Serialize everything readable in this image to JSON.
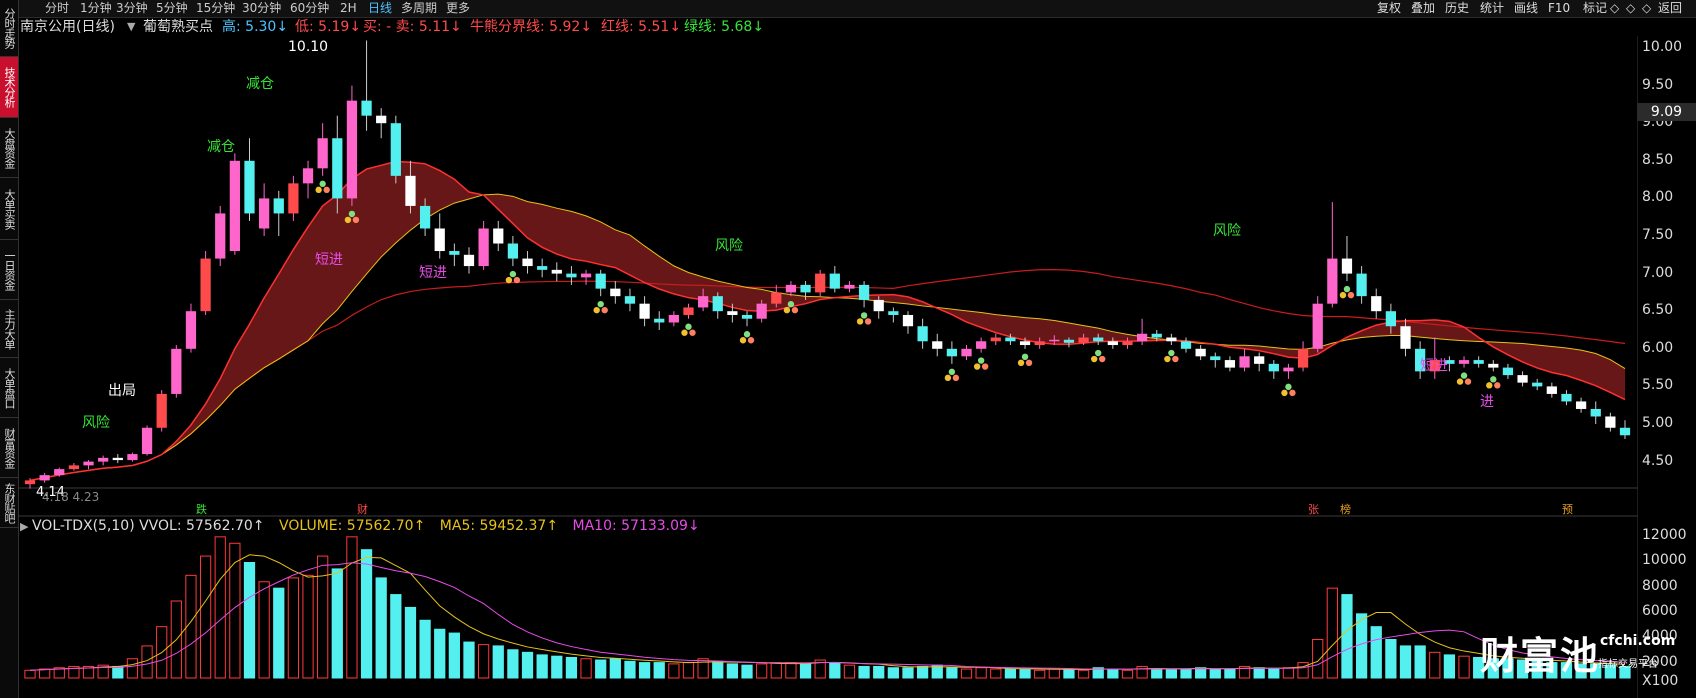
{
  "toolbar": {
    "timeframes": [
      "分时",
      "1分钟",
      "3分钟",
      "5分钟",
      "15分钟",
      "30分钟",
      "60分钟",
      "2H",
      "日线",
      "多周期",
      "更多"
    ],
    "active_timeframe": "日线",
    "right_buttons": [
      "复权",
      "叠加",
      "历史",
      "统计",
      "画线",
      "F10",
      "标记",
      "◇",
      "◇",
      "◇",
      "返回"
    ]
  },
  "sidebar": {
    "items": [
      "分时走势",
      "技术分析",
      "大盘资金",
      "大单买卖",
      "一日资金",
      "主力大单",
      "大单盘口",
      "财富资金",
      "东财贴吧"
    ],
    "active": "技术分析"
  },
  "header": {
    "stock": "南京公用(日线)",
    "indicator": "葡萄熟买点",
    "high_label": "高: 5.30↓",
    "low_label": "低: 5.19↓",
    "buysell_label": "买: - 卖: 5.11↓",
    "bull_label": "牛熊分界线: 5.92↓",
    "red_label": "红线: 5.51↓",
    "green_label": "绿线: 5.68↓"
  },
  "price_axis": {
    "ticks": [
      "10.00",
      "9.50",
      "9.00",
      "8.50",
      "8.00",
      "7.50",
      "7.00",
      "6.50",
      "6.00",
      "5.50",
      "5.00",
      "4.50"
    ],
    "current_price": "9.09",
    "max_label": "10.10",
    "min_label": "4.14",
    "min_label2": "4.18 4.23"
  },
  "signals": [
    {
      "text": "风险",
      "color": "#37e337"
    },
    {
      "text": "出局",
      "color": "#ffffff"
    },
    {
      "text": "减仓",
      "color": "#37e337"
    },
    {
      "text": "减仓",
      "color": "#37e337"
    },
    {
      "text": "风险",
      "color": "#37e337"
    },
    {
      "text": "风险",
      "color": "#37e337"
    },
    {
      "text": "短进",
      "color": "#e84ce8"
    },
    {
      "text": "短进",
      "color": "#e84ce8"
    },
    {
      "text": "短进",
      "color": "#e84ce8"
    },
    {
      "text": "进",
      "color": "#e84ce8"
    }
  ],
  "events": [
    "跌",
    "财",
    "张",
    "榜",
    "预"
  ],
  "volume": {
    "label": "VOL-TDX(5,10) VVOL: 57562.70↑",
    "volume_label": "VOLUME: 57562.70↑",
    "ma5_label": "MA5: 59452.37↑",
    "ma10_label": "MA10: 57133.09↓",
    "ticks": [
      "12000",
      "10000",
      "8000",
      "6000",
      "4000",
      "2000"
    ],
    "unit": "X100"
  },
  "watermark": {
    "logo": "财富池",
    "domain": "cfchi.com",
    "slogan": "指标交易平台"
  },
  "colors": {
    "up": "#ff3a3a",
    "pink": "#ff66cc",
    "cyan": "#54f0f0",
    "green": "#37e337",
    "magenta": "#e84ce8",
    "yellow": "#e6c21a"
  },
  "chart_data": {
    "type": "candlestick",
    "price_range": [
      4.2,
      10.15
    ],
    "volume_range": [
      0,
      12000
    ],
    "candles": [
      [
        4.2,
        4.25,
        4.28,
        4.14
      ],
      [
        4.25,
        4.32,
        4.35,
        4.22
      ],
      [
        4.32,
        4.4,
        4.42,
        4.3
      ],
      [
        4.4,
        4.45,
        4.48,
        4.38
      ],
      [
        4.45,
        4.5,
        4.52,
        4.4
      ],
      [
        4.5,
        4.55,
        4.58,
        4.45
      ],
      [
        4.55,
        4.52,
        4.6,
        4.48
      ],
      [
        4.52,
        4.6,
        4.62,
        4.5
      ],
      [
        4.6,
        4.95,
        4.98,
        4.58
      ],
      [
        4.95,
        5.4,
        5.45,
        4.9
      ],
      [
        5.4,
        6.0,
        6.05,
        5.35
      ],
      [
        6.0,
        6.5,
        6.6,
        5.95
      ],
      [
        6.5,
        7.2,
        7.3,
        6.45
      ],
      [
        7.2,
        7.8,
        7.9,
        7.1
      ],
      [
        7.3,
        8.5,
        8.6,
        7.25
      ],
      [
        8.5,
        7.8,
        8.8,
        7.7
      ],
      [
        7.6,
        8.0,
        8.2,
        7.5
      ],
      [
        8.0,
        7.8,
        8.1,
        7.5
      ],
      [
        7.8,
        8.2,
        8.3,
        7.7
      ],
      [
        8.2,
        8.4,
        8.5,
        8.0
      ],
      [
        8.4,
        8.8,
        9.0,
        8.3
      ],
      [
        8.8,
        8.0,
        9.1,
        7.8
      ],
      [
        8.0,
        9.3,
        9.5,
        7.9
      ],
      [
        9.3,
        9.1,
        10.1,
        8.9
      ],
      [
        9.1,
        9.0,
        9.2,
        8.8
      ],
      [
        9.0,
        8.3,
        9.1,
        8.2
      ],
      [
        8.3,
        7.9,
        8.5,
        7.8
      ],
      [
        7.9,
        7.6,
        8.0,
        7.5
      ],
      [
        7.6,
        7.3,
        7.8,
        7.2
      ],
      [
        7.3,
        7.25,
        7.4,
        7.1
      ],
      [
        7.25,
        7.1,
        7.35,
        7.0
      ],
      [
        7.1,
        7.6,
        7.7,
        7.05
      ],
      [
        7.6,
        7.4,
        7.7,
        7.3
      ],
      [
        7.4,
        7.2,
        7.5,
        7.1
      ],
      [
        7.2,
        7.1,
        7.3,
        7.0
      ],
      [
        7.1,
        7.05,
        7.2,
        6.95
      ],
      [
        7.05,
        7.0,
        7.15,
        6.9
      ],
      [
        7.0,
        6.95,
        7.1,
        6.85
      ],
      [
        6.95,
        7.0,
        7.05,
        6.85
      ],
      [
        7.0,
        6.8,
        7.05,
        6.7
      ],
      [
        6.8,
        6.7,
        6.9,
        6.6
      ],
      [
        6.7,
        6.6,
        6.8,
        6.5
      ],
      [
        6.6,
        6.4,
        6.7,
        6.3
      ],
      [
        6.4,
        6.35,
        6.5,
        6.25
      ],
      [
        6.35,
        6.45,
        6.5,
        6.3
      ],
      [
        6.45,
        6.55,
        6.6,
        6.4
      ],
      [
        6.55,
        6.7,
        6.8,
        6.5
      ],
      [
        6.7,
        6.5,
        6.75,
        6.4
      ],
      [
        6.5,
        6.45,
        6.6,
        6.35
      ],
      [
        6.45,
        6.4,
        6.5,
        6.3
      ],
      [
        6.4,
        6.6,
        6.65,
        6.35
      ],
      [
        6.6,
        6.75,
        6.85,
        6.55
      ],
      [
        6.75,
        6.85,
        6.9,
        6.7
      ],
      [
        6.85,
        6.75,
        6.9,
        6.65
      ],
      [
        6.75,
        7.0,
        7.05,
        6.7
      ],
      [
        7.0,
        6.8,
        7.1,
        6.75
      ],
      [
        6.8,
        6.85,
        6.9,
        6.75
      ],
      [
        6.85,
        6.65,
        6.9,
        6.55
      ],
      [
        6.65,
        6.5,
        6.7,
        6.4
      ],
      [
        6.5,
        6.45,
        6.55,
        6.35
      ],
      [
        6.45,
        6.3,
        6.5,
        6.2
      ],
      [
        6.3,
        6.1,
        6.4,
        6.0
      ],
      [
        6.1,
        6.0,
        6.2,
        5.9
      ],
      [
        6.0,
        5.9,
        6.1,
        5.8
      ],
      [
        5.9,
        6.0,
        6.05,
        5.85
      ],
      [
        6.0,
        6.1,
        6.15,
        5.95
      ],
      [
        6.1,
        6.15,
        6.2,
        6.05
      ],
      [
        6.15,
        6.1,
        6.2,
        6.05
      ],
      [
        6.1,
        6.05,
        6.15,
        6.0
      ],
      [
        6.05,
        6.1,
        6.15,
        6.0
      ],
      [
        6.1,
        6.12,
        6.18,
        6.05
      ],
      [
        6.12,
        6.08,
        6.15,
        6.02
      ],
      [
        6.08,
        6.15,
        6.2,
        6.05
      ],
      [
        6.15,
        6.1,
        6.2,
        6.05
      ],
      [
        6.1,
        6.05,
        6.15,
        6.0
      ],
      [
        6.05,
        6.1,
        6.15,
        6.0
      ],
      [
        6.1,
        6.2,
        6.4,
        6.05
      ],
      [
        6.2,
        6.15,
        6.25,
        6.1
      ],
      [
        6.15,
        6.1,
        6.2,
        6.05
      ],
      [
        6.1,
        6.0,
        6.15,
        5.95
      ],
      [
        6.0,
        5.9,
        6.05,
        5.85
      ],
      [
        5.9,
        5.85,
        5.95,
        5.75
      ],
      [
        5.85,
        5.75,
        5.9,
        5.7
      ],
      [
        5.75,
        5.9,
        6.0,
        5.7
      ],
      [
        5.9,
        5.8,
        5.95,
        5.7
      ],
      [
        5.8,
        5.7,
        5.85,
        5.6
      ],
      [
        5.7,
        5.75,
        5.8,
        5.6
      ],
      [
        5.75,
        6.0,
        6.1,
        5.7
      ],
      [
        6.0,
        6.6,
        6.7,
        5.95
      ],
      [
        6.6,
        7.2,
        7.95,
        6.55
      ],
      [
        7.2,
        7.0,
        7.5,
        6.9
      ],
      [
        7.0,
        6.7,
        7.1,
        6.6
      ],
      [
        6.7,
        6.5,
        6.8,
        6.4
      ],
      [
        6.5,
        6.3,
        6.6,
        6.2
      ],
      [
        6.3,
        6.0,
        6.4,
        5.9
      ],
      [
        6.0,
        5.7,
        6.1,
        5.6
      ],
      [
        5.7,
        5.85,
        6.15,
        5.6
      ],
      [
        5.85,
        5.8,
        5.9,
        5.7
      ],
      [
        5.8,
        5.85,
        5.9,
        5.75
      ],
      [
        5.85,
        5.8,
        5.9,
        5.75
      ],
      [
        5.8,
        5.75,
        5.85,
        5.7
      ],
      [
        5.75,
        5.65,
        5.8,
        5.6
      ],
      [
        5.65,
        5.55,
        5.7,
        5.5
      ],
      [
        5.55,
        5.5,
        5.6,
        5.45
      ],
      [
        5.5,
        5.4,
        5.55,
        5.35
      ],
      [
        5.4,
        5.3,
        5.45,
        5.25
      ],
      [
        5.3,
        5.2,
        5.35,
        5.15
      ],
      [
        5.2,
        5.1,
        5.3,
        5.0
      ],
      [
        5.1,
        4.95,
        5.15,
        4.9
      ],
      [
        4.95,
        4.85,
        5.05,
        4.8
      ]
    ],
    "volumes": [
      600,
      700,
      800,
      900,
      900,
      1000,
      900,
      1500,
      2500,
      4000,
      6000,
      8000,
      9500,
      11000,
      10500,
      9000,
      7500,
      7000,
      7800,
      8000,
      9500,
      8500,
      11000,
      10000,
      7800,
      6500,
      5500,
      4500,
      3800,
      3500,
      2800,
      2600,
      2500,
      2200,
      2000,
      1800,
      1700,
      1600,
      1500,
      1400,
      1500,
      1300,
      1200,
      1200,
      1100,
      1200,
      1500,
      1300,
      1100,
      1000,
      1100,
      1200,
      1200,
      1100,
      1400,
      1200,
      1000,
      900,
      900,
      800,
      800,
      900,
      1000,
      800,
      700,
      800,
      700,
      700,
      700,
      600,
      700,
      700,
      600,
      800,
      700,
      600,
      900,
      700,
      700,
      700,
      800,
      700,
      700,
      900,
      800,
      700,
      800,
      1200,
      3000,
      7000,
      6500,
      5000,
      4000,
      3000,
      2500,
      2500,
      2000,
      1800,
      1700,
      1600,
      1500,
      1500,
      1400,
      1300,
      1200,
      1200,
      1100,
      1100,
      1000,
      900
    ]
  }
}
